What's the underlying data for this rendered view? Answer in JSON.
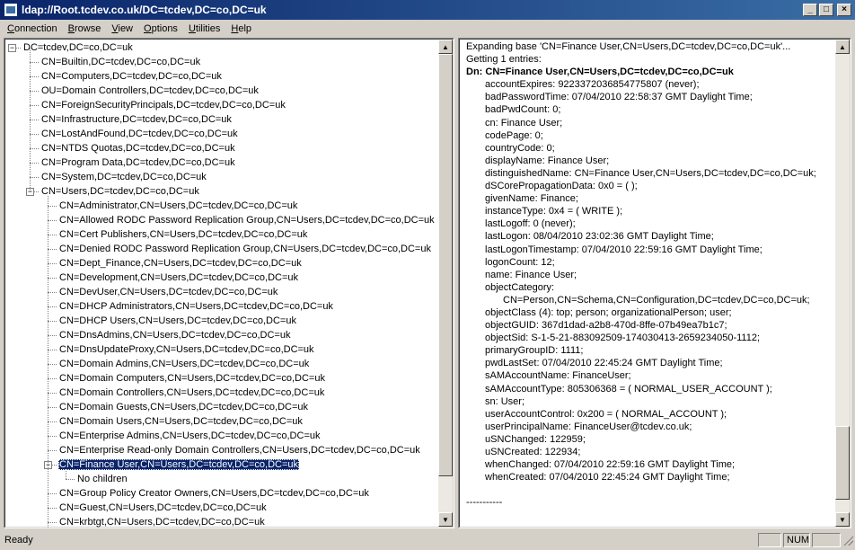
{
  "window": {
    "title": "ldap://Root.tcdev.co.uk/DC=tcdev,DC=co,DC=uk",
    "icon": "ldp-app-icon",
    "minimize": "_",
    "maximize": "□",
    "close": "×"
  },
  "menu": {
    "items": [
      {
        "mnemonic": "C",
        "rest": "onnection"
      },
      {
        "mnemonic": "B",
        "rest": "rowse"
      },
      {
        "mnemonic": "V",
        "rest": "iew"
      },
      {
        "mnemonic": "O",
        "rest": "ptions"
      },
      {
        "mnemonic": "U",
        "rest": "tilities"
      },
      {
        "mnemonic": "H",
        "rest": "elp"
      }
    ]
  },
  "tree": {
    "root": "DC=tcdev,DC=co,DC=uk",
    "level1": [
      "CN=Builtin,DC=tcdev,DC=co,DC=uk",
      "CN=Computers,DC=tcdev,DC=co,DC=uk",
      "OU=Domain Controllers,DC=tcdev,DC=co,DC=uk",
      "CN=ForeignSecurityPrincipals,DC=tcdev,DC=co,DC=uk",
      "CN=Infrastructure,DC=tcdev,DC=co,DC=uk",
      "CN=LostAndFound,DC=tcdev,DC=co,DC=uk",
      "CN=NTDS Quotas,DC=tcdev,DC=co,DC=uk",
      "CN=Program Data,DC=tcdev,DC=co,DC=uk",
      "CN=System,DC=tcdev,DC=co,DC=uk"
    ],
    "users": "CN=Users,DC=tcdev,DC=co,DC=uk",
    "users_children": [
      "CN=Administrator,CN=Users,DC=tcdev,DC=co,DC=uk",
      "CN=Allowed RODC Password Replication Group,CN=Users,DC=tcdev,DC=co,DC=uk",
      "CN=Cert Publishers,CN=Users,DC=tcdev,DC=co,DC=uk",
      "CN=Denied RODC Password Replication Group,CN=Users,DC=tcdev,DC=co,DC=uk",
      "CN=Dept_Finance,CN=Users,DC=tcdev,DC=co,DC=uk",
      "CN=Development,CN=Users,DC=tcdev,DC=co,DC=uk",
      "CN=DevUser,CN=Users,DC=tcdev,DC=co,DC=uk",
      "CN=DHCP Administrators,CN=Users,DC=tcdev,DC=co,DC=uk",
      "CN=DHCP Users,CN=Users,DC=tcdev,DC=co,DC=uk",
      "CN=DnsAdmins,CN=Users,DC=tcdev,DC=co,DC=uk",
      "CN=DnsUpdateProxy,CN=Users,DC=tcdev,DC=co,DC=uk",
      "CN=Domain Admins,CN=Users,DC=tcdev,DC=co,DC=uk",
      "CN=Domain Computers,CN=Users,DC=tcdev,DC=co,DC=uk",
      "CN=Domain Controllers,CN=Users,DC=tcdev,DC=co,DC=uk",
      "CN=Domain Guests,CN=Users,DC=tcdev,DC=co,DC=uk",
      "CN=Domain Users,CN=Users,DC=tcdev,DC=co,DC=uk",
      "CN=Enterprise Admins,CN=Users,DC=tcdev,DC=co,DC=uk",
      "CN=Enterprise Read-only Domain Controllers,CN=Users,DC=tcdev,DC=co,DC=uk"
    ],
    "selected": "CN=Finance User,CN=Users,DC=tcdev,DC=co,DC=uk",
    "selected_child": "No children",
    "after_selected": [
      "CN=Group Policy Creator Owners,CN=Users,DC=tcdev,DC=co,DC=uk",
      "CN=Guest,CN=Users,DC=tcdev,DC=co,DC=uk",
      "CN=krbtgt,CN=Users,DC=tcdev,DC=co,DC=uk"
    ]
  },
  "output": {
    "lines": [
      {
        "text": "Expanding base 'CN=Finance User,CN=Users,DC=tcdev,DC=co,DC=uk'...",
        "style": ""
      },
      {
        "text": "Getting 1 entries:",
        "style": ""
      },
      {
        "text": "Dn: CN=Finance User,CN=Users,DC=tcdev,DC=co,DC=uk",
        "style": "dn"
      },
      {
        "text": "accountExpires: 9223372036854775807 (never);",
        "style": "a1"
      },
      {
        "text": "badPasswordTime: 07/04/2010 22:58:37 GMT Daylight Time;",
        "style": "a1"
      },
      {
        "text": "badPwdCount: 0;",
        "style": "a1"
      },
      {
        "text": "cn: Finance User;",
        "style": "a1"
      },
      {
        "text": "codePage: 0;",
        "style": "a1"
      },
      {
        "text": "countryCode: 0;",
        "style": "a1"
      },
      {
        "text": "displayName: Finance User;",
        "style": "a1"
      },
      {
        "text": "distinguishedName: CN=Finance User,CN=Users,DC=tcdev,DC=co,DC=uk;",
        "style": "a1"
      },
      {
        "text": "dSCorePropagationData: 0x0 = (  );",
        "style": "a1"
      },
      {
        "text": "givenName: Finance;",
        "style": "a1"
      },
      {
        "text": "instanceType: 0x4 = ( WRITE );",
        "style": "a1"
      },
      {
        "text": "lastLogoff: 0 (never);",
        "style": "a1"
      },
      {
        "text": "lastLogon: 08/04/2010 23:02:36 GMT Daylight Time;",
        "style": "a1"
      },
      {
        "text": "lastLogonTimestamp: 07/04/2010 22:59:16 GMT Daylight Time;",
        "style": "a1"
      },
      {
        "text": "logonCount: 12;",
        "style": "a1"
      },
      {
        "text": "name: Finance User;",
        "style": "a1"
      },
      {
        "text": "objectCategory:",
        "style": "a1"
      },
      {
        "text": "CN=Person,CN=Schema,CN=Configuration,DC=tcdev,DC=co,DC=uk;",
        "style": "a2"
      },
      {
        "text": "objectClass (4): top; person; organizationalPerson; user;",
        "style": "a1"
      },
      {
        "text": "objectGUID: 367d1dad-a2b8-470d-8ffe-07b49ea7b1c7;",
        "style": "a1"
      },
      {
        "text": "objectSid: S-1-5-21-883092509-174030413-2659234050-1112;",
        "style": "a1"
      },
      {
        "text": "primaryGroupID: 1111;",
        "style": "a1"
      },
      {
        "text": "pwdLastSet: 07/04/2010 22:45:24 GMT Daylight Time;",
        "style": "a1"
      },
      {
        "text": "sAMAccountName: FinanceUser;",
        "style": "a1"
      },
      {
        "text": "sAMAccountType: 805306368 = ( NORMAL_USER_ACCOUNT );",
        "style": "a1"
      },
      {
        "text": "sn: User;",
        "style": "a1"
      },
      {
        "text": "userAccountControl: 0x200 = ( NORMAL_ACCOUNT );",
        "style": "a1"
      },
      {
        "text": "userPrincipalName: FinanceUser@tcdev.co.uk;",
        "style": "a1"
      },
      {
        "text": "uSNChanged: 122959;",
        "style": "a1"
      },
      {
        "text": "uSNCreated: 122934;",
        "style": "a1"
      },
      {
        "text": "whenChanged: 07/04/2010 22:59:16 GMT Daylight Time;",
        "style": "a1"
      },
      {
        "text": "whenCreated: 07/04/2010 22:45:24 GMT Daylight Time;",
        "style": "a1"
      },
      {
        "text": "",
        "style": ""
      },
      {
        "text": "-----------",
        "style": ""
      }
    ]
  },
  "status": {
    "text": "Ready",
    "cells": [
      "",
      "NUM",
      ""
    ]
  },
  "scroll": {
    "up": "▲",
    "down": "▼"
  }
}
